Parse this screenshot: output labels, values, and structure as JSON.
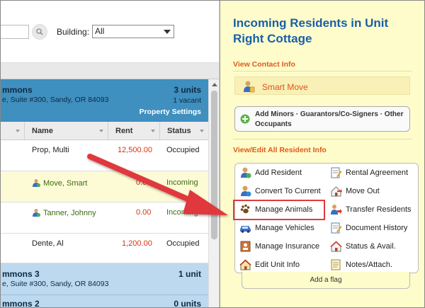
{
  "search": {
    "placeholder": ""
  },
  "filter": {
    "building_label": "Building:",
    "building_value": "All"
  },
  "property1": {
    "name": "mmons",
    "address": "e, Suite #300, Sandy, OR 84093",
    "units": "3 units",
    "vacant": "1 vacant",
    "settings_label": "Property Settings"
  },
  "table": {
    "columns": [
      "Name",
      "Rent",
      "Status"
    ],
    "rows": [
      {
        "name": "Prop, Multi",
        "rent": "12,500.00",
        "status": "Occupied"
      },
      {
        "name": "Move, Smart",
        "rent": "0.0",
        "status": "Incoming"
      },
      {
        "name": "Tanner, Johnny",
        "rent": "0.00",
        "status": "Incoming"
      },
      {
        "name": "Dente, Al",
        "rent": "1,200.00",
        "status": "Occupied"
      }
    ]
  },
  "property2": {
    "name": "mmons 3",
    "address": "e, Suite #300, Sandy, OR 84093",
    "units": "1 unit"
  },
  "property3": {
    "name": "mmons 2",
    "units": "0 units"
  },
  "panel": {
    "title": "Incoming Residents in Unit Right Cottage",
    "view_contact": "View Contact Info",
    "smart_move": "Smart Move",
    "add_minors": "Add Minors · Guarantors/Co-Signers · Other Occupants",
    "view_edit": "View/Edit All Resident Info",
    "actions": [
      "Add Resident",
      "Rental Agreement",
      "Convert To Current",
      "Move Out",
      "Manage Animals",
      "Transfer Residents",
      "Manage Vehicles",
      "Document History",
      "Manage Insurance",
      "Status & Avail.",
      "Edit Unit Info",
      "Notes/Attach."
    ],
    "add_flag": "Add a flag"
  },
  "colors": {
    "accent_blue": "#1a5fa8",
    "orange": "#e05a1a",
    "highlight_red": "#e0393e",
    "panel_yellow": "#fefccb"
  }
}
